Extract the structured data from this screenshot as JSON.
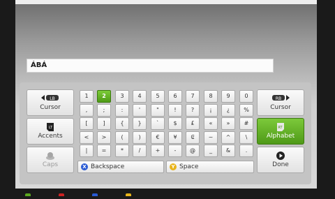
{
  "text_field": {
    "value": "ÁBÁ"
  },
  "side_buttons": {
    "cursor_left": {
      "bumper": "LB",
      "label": "Cursor"
    },
    "accents": {
      "label": "Accents",
      "trigger": "LT"
    },
    "caps": {
      "label": "Caps"
    },
    "cursor_right": {
      "bumper": "RB",
      "label": "Cursor"
    },
    "alphabet": {
      "label": "Alphabet",
      "trigger": "RT"
    },
    "done": {
      "label": "Done"
    }
  },
  "keys": {
    "row1": [
      "1",
      "2",
      "3",
      "4",
      "5",
      "6",
      "7",
      "8",
      "9",
      "0"
    ],
    "row2": [
      ",",
      ";",
      ":",
      "'",
      "\"",
      "!",
      "?",
      "¡",
      "¿",
      "%"
    ],
    "row3": [
      "[",
      "]",
      "{",
      "}",
      "`",
      "$",
      "£",
      "«",
      "»",
      "#"
    ],
    "row4": [
      "<",
      ">",
      "(",
      ")",
      "€",
      "¥",
      "₢",
      "~",
      "^",
      "\\"
    ],
    "row5": [
      "|",
      "=",
      "*",
      "/",
      "+",
      "-",
      "@",
      "_",
      "&",
      "."
    ]
  },
  "selected_key": "2",
  "bottom_buttons": {
    "backspace": {
      "button": "X",
      "label": "Backspace",
      "color": "#2a5bd4"
    },
    "space": {
      "button": "Y",
      "label": "Space",
      "color": "#e8b41a"
    }
  },
  "colors": {
    "green": "#5ca81f",
    "red": "#c22",
    "blue": "#2a5bd4",
    "yellow": "#e8b41a"
  }
}
